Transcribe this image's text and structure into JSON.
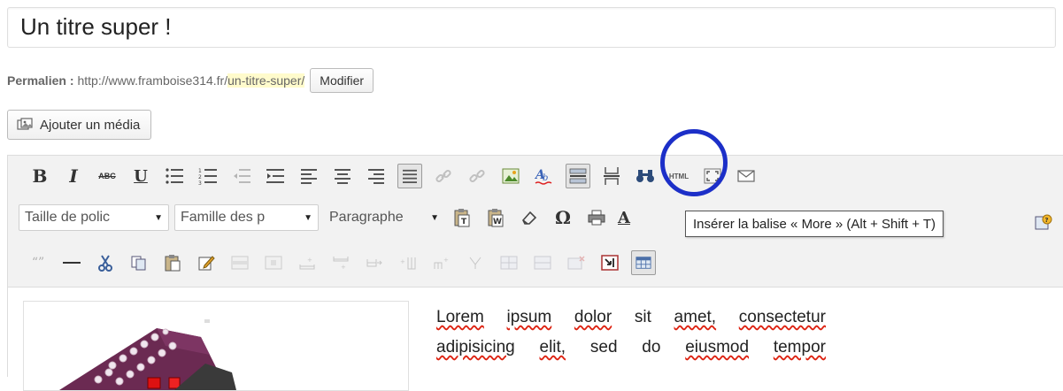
{
  "post": {
    "title": "Un titre super !"
  },
  "permalink": {
    "label": "Permalien :",
    "url_prefix": "http://www.framboise314.fr/",
    "slug": "un-titre-super/",
    "edit_button": "Modifier"
  },
  "media_button": {
    "label": "Ajouter un média",
    "icon": "media-icon"
  },
  "toolbar": {
    "row1": [
      {
        "name": "bold",
        "icon": "B"
      },
      {
        "name": "italic",
        "icon": "I"
      },
      {
        "name": "strikethrough",
        "icon": "ABC"
      },
      {
        "name": "underline",
        "icon": "U"
      },
      {
        "name": "bullet-list",
        "icon": "bullist-icon"
      },
      {
        "name": "numbered-list",
        "icon": "numlist-icon"
      },
      {
        "name": "outdent",
        "icon": "outdent-icon"
      },
      {
        "name": "indent",
        "icon": "indent-icon"
      },
      {
        "name": "align-left",
        "icon": "align-left-icon"
      },
      {
        "name": "align-center",
        "icon": "align-center-icon"
      },
      {
        "name": "align-right",
        "icon": "align-right-icon"
      },
      {
        "name": "justify",
        "icon": "justify-icon"
      },
      {
        "name": "link",
        "icon": "link-icon"
      },
      {
        "name": "unlink",
        "icon": "unlink-icon"
      },
      {
        "name": "image",
        "icon": "image-icon"
      },
      {
        "name": "spellcheck",
        "icon": "spellcheck-icon"
      },
      {
        "name": "more",
        "icon": "more-tag-icon"
      },
      {
        "name": "page-break",
        "icon": "pagebreak-icon"
      },
      {
        "name": "find",
        "icon": "binoculars-icon"
      },
      {
        "name": "html",
        "icon": "HTML"
      },
      {
        "name": "fullscreen",
        "icon": "fullscreen-icon"
      },
      {
        "name": "email",
        "icon": "envelope-icon"
      }
    ],
    "row2": {
      "font_size": "Taille de polic",
      "font_family": "Famille des p",
      "format": "Paragraphe",
      "tooltip": "Insérer la balise « More » (Alt + Shift + T)"
    }
  },
  "content": {
    "paragraph_line1_words": [
      "Lorem",
      "ipsum",
      "dolor",
      "sit",
      "amet,",
      "consectetur"
    ],
    "paragraph_line2_words": [
      "adipisicing",
      "elit,",
      "sed",
      "do",
      "eiusmod",
      "tempor"
    ]
  },
  "colors": {
    "highlight_circle": "#1c2fc8",
    "slug_highlight": "#fffbcc",
    "toolbar_bg": "#f2f2f2"
  }
}
